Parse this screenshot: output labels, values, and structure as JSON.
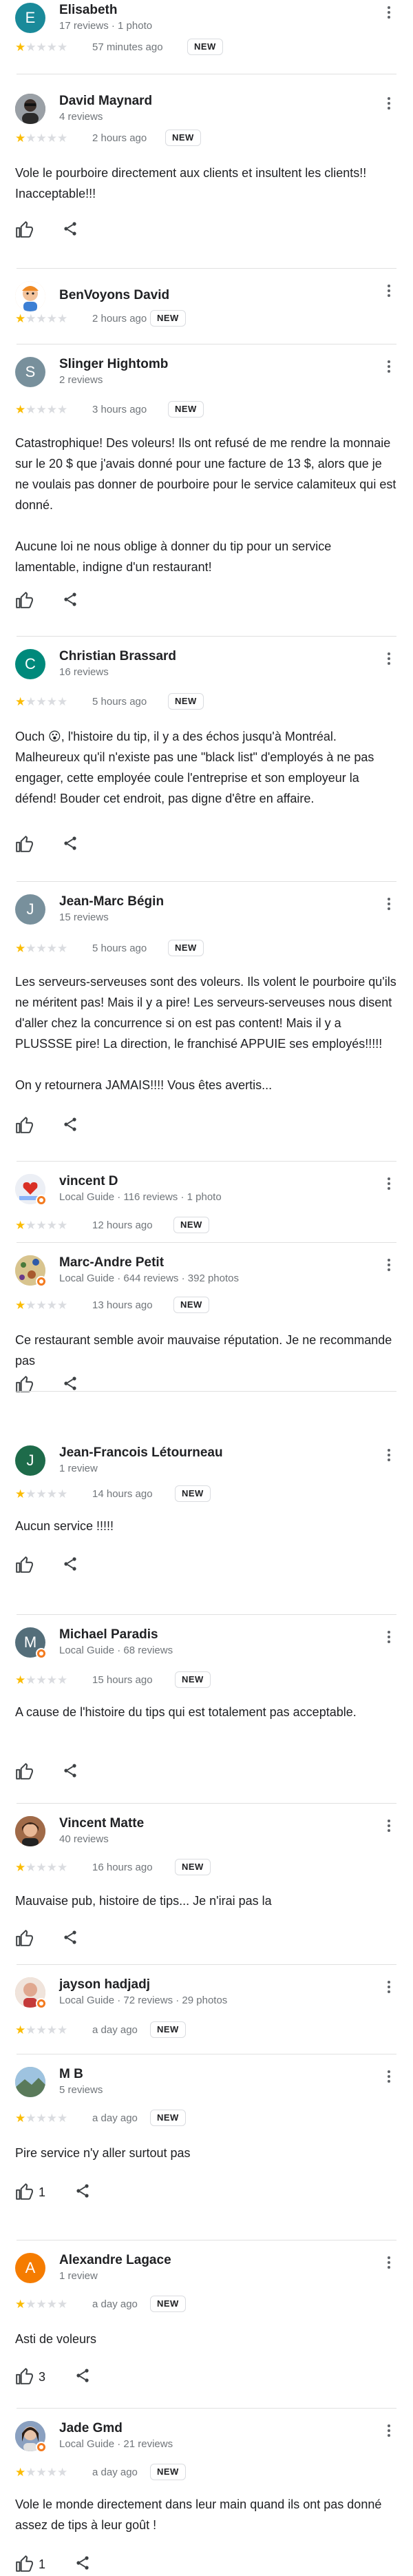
{
  "colors": {
    "star_on": "#fbbc04",
    "star_off": "#dadce0",
    "guide_badge": "#f37a1f"
  },
  "icons": {
    "like": "thumbs-up-icon",
    "share": "share-icon",
    "menu": "more-vert-icon"
  },
  "reviews": [
    {
      "avatar_letter": "E",
      "avatar_color": "#1a8a9a",
      "name": "Elisabeth",
      "stats": "17 reviews · 1 photo",
      "stars": 1,
      "time": "57 minutes ago",
      "badge": "NEW",
      "text": "",
      "likes": ""
    },
    {
      "avatar_letter": "",
      "avatar_color": "#4a4a4a",
      "name": "David Maynard",
      "stats": "4 reviews",
      "stars": 1,
      "time": "2 hours ago",
      "badge": "NEW",
      "text": "Vole le pourboire directement aux clients et insultent les clients!! Inacceptable!!!",
      "likes": ""
    },
    {
      "avatar_letter": "",
      "avatar_color": "#f5c8a0",
      "name": "BenVoyons David",
      "stats": "",
      "stars": 1,
      "time": "2 hours ago",
      "badge": "NEW",
      "text": "",
      "likes": ""
    },
    {
      "avatar_letter": "S",
      "avatar_color": "#78909c",
      "name": "Slinger Hightomb",
      "stats": "2 reviews",
      "stars": 1,
      "time": "3 hours ago",
      "badge": "NEW",
      "text": "Catastrophique! Des voleurs! Ils ont refusé de me rendre la monnaie sur le 20 $ que j'avais donné pour une facture de 13 $, alors que je ne voulais pas donner de pourboire pour le service calamiteux qui est donné.\n\nAucune loi ne nous oblige à donner du tip pour un service lamentable, indigne d'un restaurant!",
      "likes": ""
    },
    {
      "avatar_letter": "C",
      "avatar_color": "#00897b",
      "name": "Christian Brassard",
      "stats": "16 reviews",
      "stars": 1,
      "time": "5 hours ago",
      "badge": "NEW",
      "text": "Ouch 😮, l'histoire du tip, il y a des échos jusqu'à Montréal.  Malheureux qu'il n'existe pas une \"black list\" d'employés à ne pas engager, cette employée coule l'entreprise et son employeur la défend!  Bouder cet endroit, pas digne d'être en affaire.",
      "likes": ""
    },
    {
      "avatar_letter": "J",
      "avatar_color": "#78909c",
      "name": "Jean-Marc Bégin",
      "stats": "15 reviews",
      "stars": 1,
      "time": "5 hours ago",
      "badge": "NEW",
      "text": "Les serveurs-serveuses sont des voleurs. Ils volent le pourboire qu'ils ne méritent pas! Mais il y a pire! Les serveurs-serveuses nous disent d'aller chez la concurrence si on est pas content! Mais il y a PLUSSSE pire! La direction, le franchisé APPUIE ses employés!!!!!\n\nOn y retournera JAMAIS!!!! Vous êtes avertis...",
      "likes": ""
    },
    {
      "avatar_letter": "",
      "avatar_color": "#e8e8f0",
      "name": "vincent D",
      "stats": "Local Guide · 116 reviews · 1 photo",
      "stars": 1,
      "time": "12 hours ago",
      "badge": "NEW",
      "text": "",
      "likes": ""
    },
    {
      "avatar_letter": "",
      "avatar_color": "#c9b98a",
      "name": "Marc-Andre Petit",
      "stats": "Local Guide · 644 reviews · 392 photos",
      "stars": 1,
      "time": "13 hours ago",
      "badge": "NEW",
      "text": "Ce restaurant semble avoir mauvaise réputation. Je ne recommande pas",
      "likes": ""
    },
    {
      "avatar_letter": "J",
      "avatar_color": "#1e6b4a",
      "name": "Jean-Francois Létourneau",
      "stats": "1 review",
      "stars": 1,
      "time": "14 hours ago",
      "badge": "NEW",
      "text": "Aucun service  !!!!!",
      "likes": ""
    },
    {
      "avatar_letter": "M",
      "avatar_color": "#546e7a",
      "name": "Michael Paradis",
      "stats": "Local Guide · 68 reviews",
      "stars": 1,
      "time": "15 hours ago",
      "badge": "NEW",
      "text": "A cause de l'histoire du tips qui est totalement pas acceptable.",
      "likes": ""
    },
    {
      "avatar_letter": "",
      "avatar_color": "#8d5a3c",
      "name": "Vincent Matte",
      "stats": "40 reviews",
      "stars": 1,
      "time": "16 hours ago",
      "badge": "NEW",
      "text": "Mauvaise pub, histoire de tips... Je n'irai pas la",
      "likes": ""
    },
    {
      "avatar_letter": "",
      "avatar_color": "#d7a888",
      "name": "jayson hadjadj",
      "stats": "Local Guide · 72 reviews · 29 photos",
      "stars": 1,
      "time": "a day ago",
      "badge": "NEW",
      "text": "",
      "likes": ""
    },
    {
      "avatar_letter": "",
      "avatar_color": "#7a9a8a",
      "name": "M B",
      "stats": "5 reviews",
      "stars": 1,
      "time": "a day ago",
      "badge": "NEW",
      "text": "Pire service n'y aller surtout pas",
      "likes": "1"
    },
    {
      "avatar_letter": "A",
      "avatar_color": "#f57c00",
      "name": "Alexandre Lagace",
      "stats": "1 review",
      "stars": 1,
      "time": "a day ago",
      "badge": "NEW",
      "text": "Asti de voleurs",
      "likes": "3"
    },
    {
      "avatar_letter": "",
      "avatar_color": "#6a7fa0",
      "name": "Jade Gmd",
      "stats": "Local Guide · 21 reviews",
      "stars": 1,
      "time": "a day ago",
      "badge": "NEW",
      "text": "Vole le monde directement dans leur main quand ils ont pas donné assez de tips à leur goût !",
      "likes": "1"
    }
  ]
}
